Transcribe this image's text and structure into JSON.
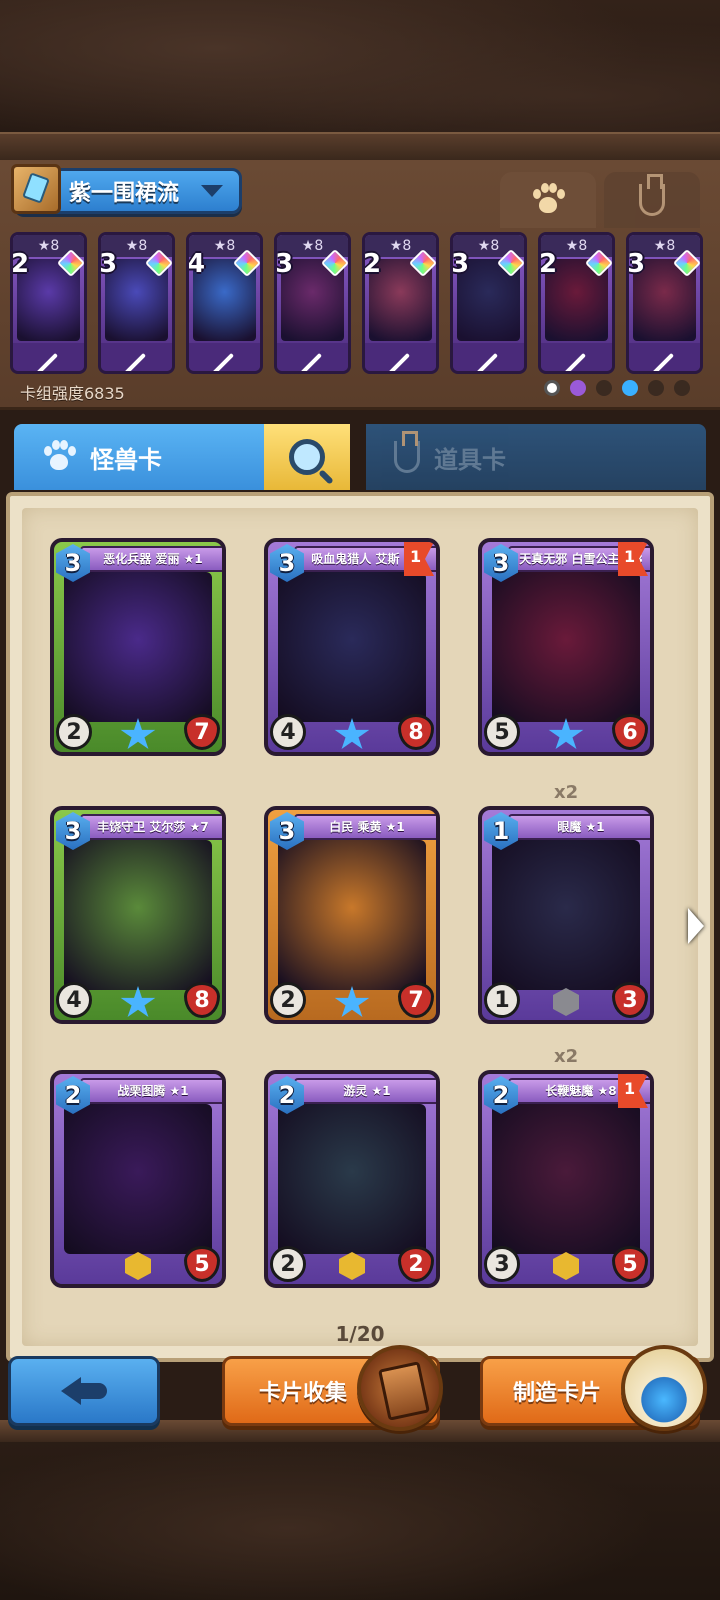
{
  "deck": {
    "name": "紫一围裙流",
    "strength_label": "卡组强度6835",
    "mini_cards": [
      {
        "cost": "2",
        "stars": "★8",
        "art": "#5a3aa8"
      },
      {
        "cost": "3",
        "stars": "★8",
        "art": "#4a4ab8"
      },
      {
        "cost": "4",
        "stars": "★8",
        "art": "#3a6ac8"
      },
      {
        "cost": "3",
        "stars": "★8",
        "art": "#6a2a6a"
      },
      {
        "cost": "2",
        "stars": "★8",
        "art": "#8a3a5a"
      },
      {
        "cost": "3",
        "stars": "★8",
        "art": "#2a2a5a"
      },
      {
        "cost": "2",
        "stars": "★8",
        "art": "#6a1a3a"
      },
      {
        "cost": "3",
        "stars": "★8",
        "art": "#7a2a4a"
      }
    ]
  },
  "tabs": {
    "monster_label": "怪兽卡",
    "item_label": "道具卡"
  },
  "cards": [
    {
      "name": "恶化兵器 爱丽 ★1",
      "cost": "3",
      "atk": "2",
      "hp": "7",
      "flag": "",
      "color": "green",
      "art": "#4a2a8a",
      "badge": "star",
      "count_label": ""
    },
    {
      "name": "吸血鬼猎人 艾斯 ★8",
      "cost": "3",
      "atk": "4",
      "hp": "8",
      "flag": "1",
      "color": "purple",
      "art": "#2a2a5a",
      "badge": "star",
      "count_label": ""
    },
    {
      "name": "天真无邪 白雪公主 ★8",
      "cost": "3",
      "atk": "5",
      "hp": "6",
      "flag": "1",
      "color": "purple",
      "art": "#6a1a3a",
      "badge": "star",
      "count_label": ""
    },
    {
      "name": "丰饶守卫 艾尔莎 ★7",
      "cost": "3",
      "atk": "4",
      "hp": "8",
      "flag": "",
      "color": "green",
      "art": "#5a8a3a",
      "badge": "star",
      "count_label": ""
    },
    {
      "name": "白民 乘黄 ★1",
      "cost": "3",
      "atk": "2",
      "hp": "7",
      "flag": "",
      "color": "orange",
      "art": "#c8782a",
      "badge": "star",
      "count_label": ""
    },
    {
      "name": "眼魔 ★1",
      "cost": "1",
      "atk": "1",
      "hp": "3",
      "flag": "",
      "color": "purple",
      "art": "#2a2a4a",
      "badge": "grey",
      "count_label": "x2"
    },
    {
      "name": "战栗图腾 ★1",
      "cost": "2",
      "atk": "",
      "hp": "5",
      "flag": "",
      "color": "purple",
      "art": "#3a1a5a",
      "badge": "hex",
      "count_label": ""
    },
    {
      "name": "游灵 ★1",
      "cost": "2",
      "atk": "2",
      "hp": "2",
      "flag": "",
      "color": "purple",
      "art": "#2a3a4a",
      "badge": "hex",
      "count_label": ""
    },
    {
      "name": "长鞭魅魔 ★8",
      "cost": "2",
      "atk": "3",
      "hp": "5",
      "flag": "1",
      "color": "purple",
      "art": "#4a1a3a",
      "badge": "hex",
      "count_label": "x2"
    }
  ],
  "pagination": {
    "label": "1/20"
  },
  "buttons": {
    "collect_label": "卡片收集",
    "craft_label": "制造卡片"
  }
}
